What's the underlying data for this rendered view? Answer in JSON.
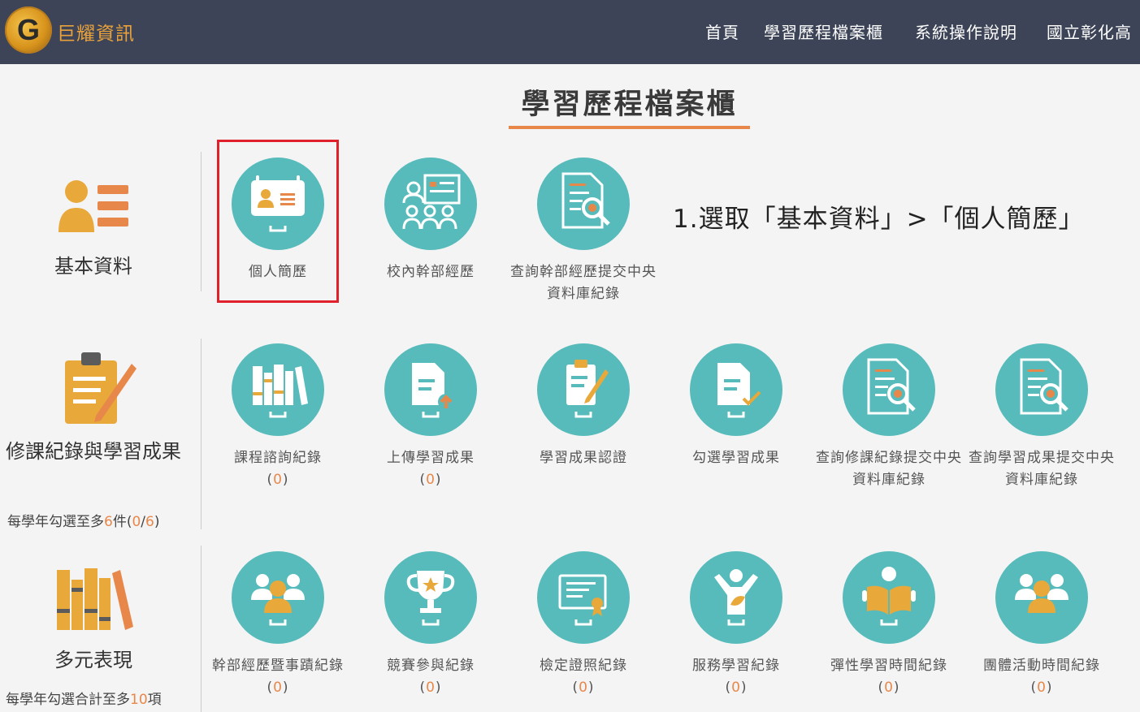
{
  "header": {
    "brand": "巨耀資訊",
    "logo_letter": "G",
    "nav": [
      "首頁",
      "學習歷程檔案櫃",
      "系統操作說明",
      "國立彰化高"
    ]
  },
  "page_title": "學習歷程檔案櫃",
  "instruction": "1.選取「基本資料」>「個人簡歷」",
  "sections": [
    {
      "label": "基本資料",
      "items": [
        {
          "label": "個人簡歷",
          "icon": "id-card-icon"
        },
        {
          "label": "校內幹部經歷",
          "icon": "group-board-icon"
        },
        {
          "label": "查詢幹部經歷提交中央資料庫紀錄",
          "icon": "document-search-icon"
        }
      ]
    },
    {
      "label": "修課紀錄與學習成果",
      "sub": {
        "prefix": "每學年勾選至多",
        "max": "6",
        "unit": "件(",
        "current": "0",
        "sep": "/",
        "limit": "6",
        "suffix": ")"
      },
      "items": [
        {
          "label": "課程諮詢紀錄",
          "count": "0",
          "icon": "books-icon"
        },
        {
          "label": "上傳學習成果",
          "count": "0",
          "icon": "upload-document-icon"
        },
        {
          "label": "學習成果認證",
          "icon": "clipboard-edit-icon"
        },
        {
          "label": "勾選學習成果",
          "icon": "document-check-icon"
        },
        {
          "label": "查詢修課紀錄提交中央資料庫紀錄",
          "icon": "document-search-icon"
        },
        {
          "label": "查詢學習成果提交中央資料庫紀錄",
          "icon": "document-search-icon"
        }
      ]
    },
    {
      "label": "多元表現",
      "sub": {
        "prefix": "每學年勾選合計至多",
        "max": "10",
        "suffix": "項"
      },
      "items": [
        {
          "label": "幹部經歷暨事蹟紀錄",
          "count": "0",
          "icon": "people-icon"
        },
        {
          "label": "競賽參與紀錄",
          "count": "0",
          "icon": "trophy-icon"
        },
        {
          "label": "檢定證照紀錄",
          "count": "0",
          "icon": "certificate-icon"
        },
        {
          "label": "服務學習紀錄",
          "count": "0",
          "icon": "volunteer-icon"
        },
        {
          "label": "彈性學習時間紀錄",
          "count": "0",
          "icon": "reading-icon"
        },
        {
          "label": "團體活動時間紀錄",
          "count": "0",
          "icon": "people-icon"
        }
      ]
    }
  ],
  "colors": {
    "header_bg": "#3d4457",
    "accent": "#e8874a",
    "circle": "#58bbbb",
    "highlight": "#e0202a"
  }
}
